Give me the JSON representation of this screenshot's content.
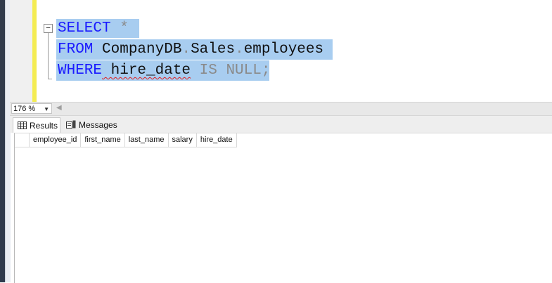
{
  "editor": {
    "lines": {
      "l1": {
        "keyword": "SELECT",
        "rest": " *"
      },
      "l2": {
        "keyword": "FROM",
        "db": " CompanyDB",
        "dot1": ".",
        "schema": "Sales",
        "dot2": ".",
        "table": "employees"
      },
      "l3": {
        "keyword": "WHERE",
        "column": " hire_date",
        "cond": " IS NULL;"
      }
    },
    "fold_symbol": "−"
  },
  "status": {
    "zoom_value": "176 %",
    "scroll_left_glyph": "◀"
  },
  "tabs": {
    "results": "Results",
    "messages": "Messages"
  },
  "grid": {
    "columns": [
      "employee_id",
      "first_name",
      "last_name",
      "salary",
      "hire_date"
    ],
    "rows": []
  },
  "colors": {
    "keyword": "#1a1aff",
    "selection": "#a8cdf0",
    "change_bar": "#f4ec52",
    "frame": "#2f3a4d"
  },
  "icons": {
    "fold": "collapse-icon",
    "results": "grid-icon",
    "messages": "messages-icon",
    "zoom": "chevron-down-icon"
  }
}
